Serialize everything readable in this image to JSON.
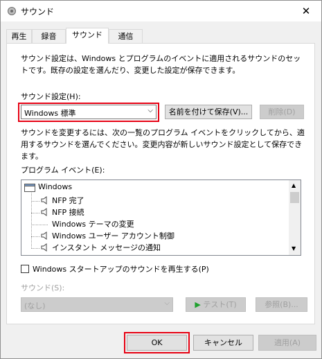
{
  "window": {
    "title": "サウンド",
    "close_glyph": "✕"
  },
  "tabs": [
    {
      "label": "再生"
    },
    {
      "label": "録音"
    },
    {
      "label": "サウンド"
    },
    {
      "label": "通信"
    }
  ],
  "panel": {
    "description": "サウンド設定は、Windows とプログラムのイベントに適用されるサウンドのセットです。既存の設定を選んだり、変更した設定が保存できます。",
    "scheme_label": "サウンド設定(H):",
    "scheme_value": "Windows 標準",
    "save_as_button": "名前を付けて保存(V)...",
    "delete_button": "削除(D)",
    "instruction": "サウンドを変更するには、次の一覧のプログラム イベントをクリックしてから、適用するサウンドを選んでください。変更内容が新しいサウンド設定として保存できます。",
    "program_events_label": "プログラム イベント(E):",
    "events": [
      {
        "label": "Windows",
        "kind": "group"
      },
      {
        "label": "NFP 完了",
        "kind": "sound"
      },
      {
        "label": "NFP 接続",
        "kind": "sound"
      },
      {
        "label": "Windows テーマの変更",
        "kind": "none"
      },
      {
        "label": "Windows ユーザー アカウント制御",
        "kind": "sound"
      },
      {
        "label": "インスタント メッセージの通知",
        "kind": "sound"
      }
    ],
    "startup_checkbox_label": "Windows スタートアップのサウンドを再生する(P)",
    "startup_checked": false,
    "sound_label": "サウンド(S):",
    "sound_value": "(なし)",
    "test_button": "テスト(T)",
    "browse_button": "参照(B)..."
  },
  "footer": {
    "ok": "OK",
    "cancel": "キャンセル",
    "apply": "適用(A)"
  },
  "colors": {
    "highlight": "#e60012",
    "green": "#1fa12e"
  }
}
